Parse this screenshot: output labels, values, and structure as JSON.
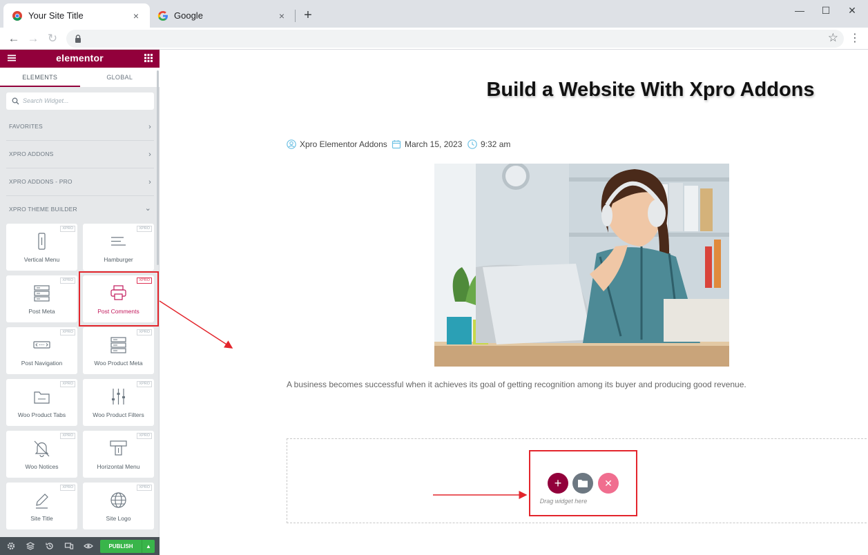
{
  "browser": {
    "tabs": [
      {
        "title": "Your Site Title",
        "active": true
      },
      {
        "title": "Google",
        "active": false
      }
    ],
    "new_tab_label": "+",
    "close_glyph": "×",
    "window_controls": {
      "minimize": "—",
      "maximize": "☐",
      "close": "✕"
    },
    "nav": {
      "back": "←",
      "forward": "→",
      "reload": "↻"
    },
    "bookmark_glyph": "☆",
    "menu_glyph": "⋮"
  },
  "panel": {
    "logo": "elementor",
    "tabs": [
      "ELEMENTS",
      "GLOBAL"
    ],
    "search_placeholder": "Search Widget...",
    "categories": [
      {
        "label": "FAVORITES",
        "chev": "›"
      },
      {
        "label": "XPRO ADDONS",
        "chev": "›"
      },
      {
        "label": "XPRO ADDONS - PRO",
        "chev": "›"
      },
      {
        "label": "XPRO THEME BUILDER",
        "chev": "⌄"
      }
    ],
    "badge": "XPRO",
    "widgets": [
      {
        "label": "Vertical Menu",
        "icon": "vertical-menu-icon"
      },
      {
        "label": "Hamburger",
        "icon": "hamburger-icon"
      },
      {
        "label": "Post Meta",
        "icon": "post-meta-icon"
      },
      {
        "label": "Post Comments",
        "icon": "post-comments-icon"
      },
      {
        "label": "Post Navigation",
        "icon": "post-navigation-icon"
      },
      {
        "label": "Woo Product Meta",
        "icon": "product-meta-icon"
      },
      {
        "label": "Woo Product Tabs",
        "icon": "product-tabs-icon"
      },
      {
        "label": "Woo Product Filters",
        "icon": "filters-icon"
      },
      {
        "label": "Woo Notices",
        "icon": "notices-icon"
      },
      {
        "label": "Horizontal Menu",
        "icon": "horizontal-menu-icon"
      },
      {
        "label": "Site Title",
        "icon": "pencil-icon"
      },
      {
        "label": "Site Logo",
        "icon": "globe-icon"
      }
    ],
    "footer": {
      "publish": "PUBLISH",
      "caret": "▲"
    }
  },
  "page": {
    "title": "Build a Website With Xpro Addons",
    "meta": {
      "author": "Xpro Elementor Addons",
      "date": "March 15, 2023",
      "time": "9:32 am"
    },
    "excerpt": "A business becomes successful when it achieves its goal of getting recognition among its buyer and producing good revenue.",
    "dropzone": {
      "add": "+",
      "close": "✕",
      "hint": "Drag widget here"
    }
  },
  "colors": {
    "elementor_brand": "#92003b",
    "publish_green": "#39b54a",
    "highlight_red": "#e3252c",
    "add_button": "#92003b",
    "template_button": "#6d7882",
    "close_button": "#f06e8f"
  }
}
